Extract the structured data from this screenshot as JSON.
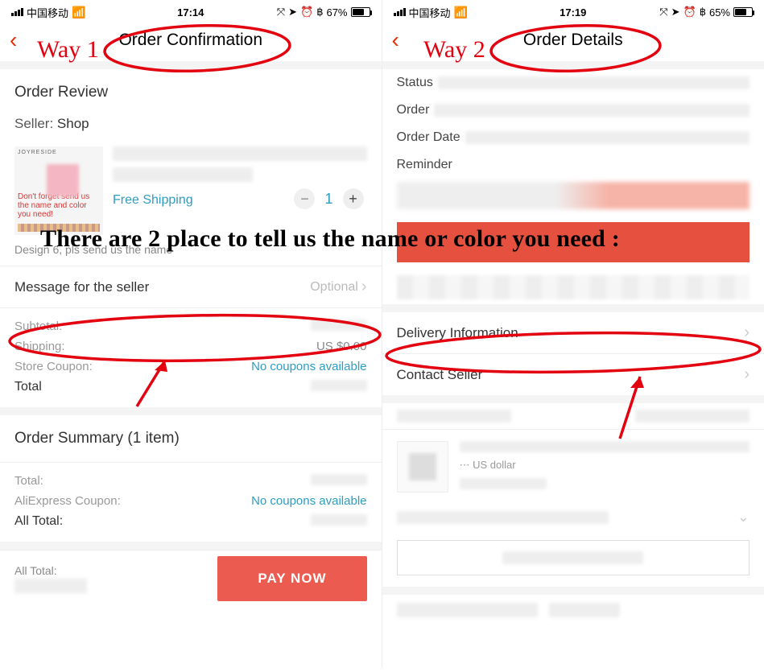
{
  "annotations": {
    "way1": "Way 1",
    "way2": "Way 2",
    "banner": "There are 2 place to tell us the name or color you need :"
  },
  "left": {
    "status": {
      "carrier": "中国移动",
      "time": "17:14",
      "battery_pct": "67%"
    },
    "nav_title": "Order Confirmation",
    "order_review": "Order Review",
    "seller_label": "Seller:",
    "seller_name": "Shop",
    "product": {
      "joy": "JOYRESIDE",
      "thumb_text": "Don't forget send us the name and color you need!",
      "free_shipping": "Free Shipping",
      "quantity": "1",
      "variant_note": "Design 6, pls send us the name"
    },
    "message_row": {
      "label": "Message for the seller",
      "hint": "Optional"
    },
    "price": {
      "subtotal_label": "Subtotal:",
      "shipping_label": "Shipping:",
      "shipping_val": "US $0.00",
      "coupon_label": "Store Coupon:",
      "coupon_val": "No coupons available",
      "total_label": "Total"
    },
    "summary": {
      "title": "Order Summary (1 item)",
      "total_label": "Total:",
      "ae_coupon_label": "AliExpress Coupon:",
      "ae_coupon_val": "No coupons available",
      "all_total_label": "All Total:"
    },
    "pay": {
      "all_total": "All Total:",
      "button": "PAY NOW"
    }
  },
  "right": {
    "status": {
      "carrier": "中国移动",
      "time": "17:19",
      "battery_pct": "65%"
    },
    "nav_title": "Order Details",
    "labels": {
      "status": "Status",
      "order": "Order",
      "order_date": "Order Date",
      "reminder": "Reminder"
    },
    "delivery": "Delivery Information",
    "contact": "Contact Seller",
    "currency_note": "US dollar"
  }
}
